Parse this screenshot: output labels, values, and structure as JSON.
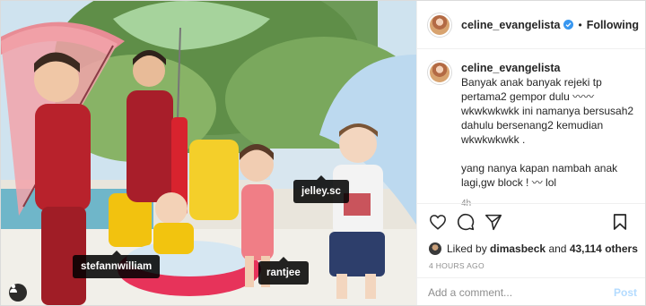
{
  "post": {
    "username": "celine_evangelista",
    "follow_status": "Following",
    "separator": "•",
    "caption": "Banyak anak banyak rejeki tp pertama2 gempor dulu 〰〰 wkwkwkwkk ini namanya bersusah2 dahulu bersenang2 kemudian wkwkwkwkk .\n\nyang nanya kapan nambah anak lagi,gw block ! 〰 lol",
    "caption_age": "4h",
    "likes": {
      "prefix": "Liked by",
      "user": "dimasbeck",
      "connector": "and",
      "count": "43,114 others"
    },
    "time_ago": "4 HOURS AGO",
    "comment_placeholder": "Add a comment...",
    "post_button": "Post"
  },
  "photo_tags": {
    "stefan": "stefannwilliam",
    "rantjee": "rantjee",
    "jelley": "jelley.sc"
  },
  "colors": {
    "verified_blue": "#3897f0",
    "post_button_disabled": "#b3dbff",
    "muted_text": "#8e8e8e"
  },
  "icons": [
    "verified-badge-icon",
    "heart-icon",
    "comment-icon",
    "share-icon",
    "bookmark-icon",
    "user-tags-icon"
  ]
}
